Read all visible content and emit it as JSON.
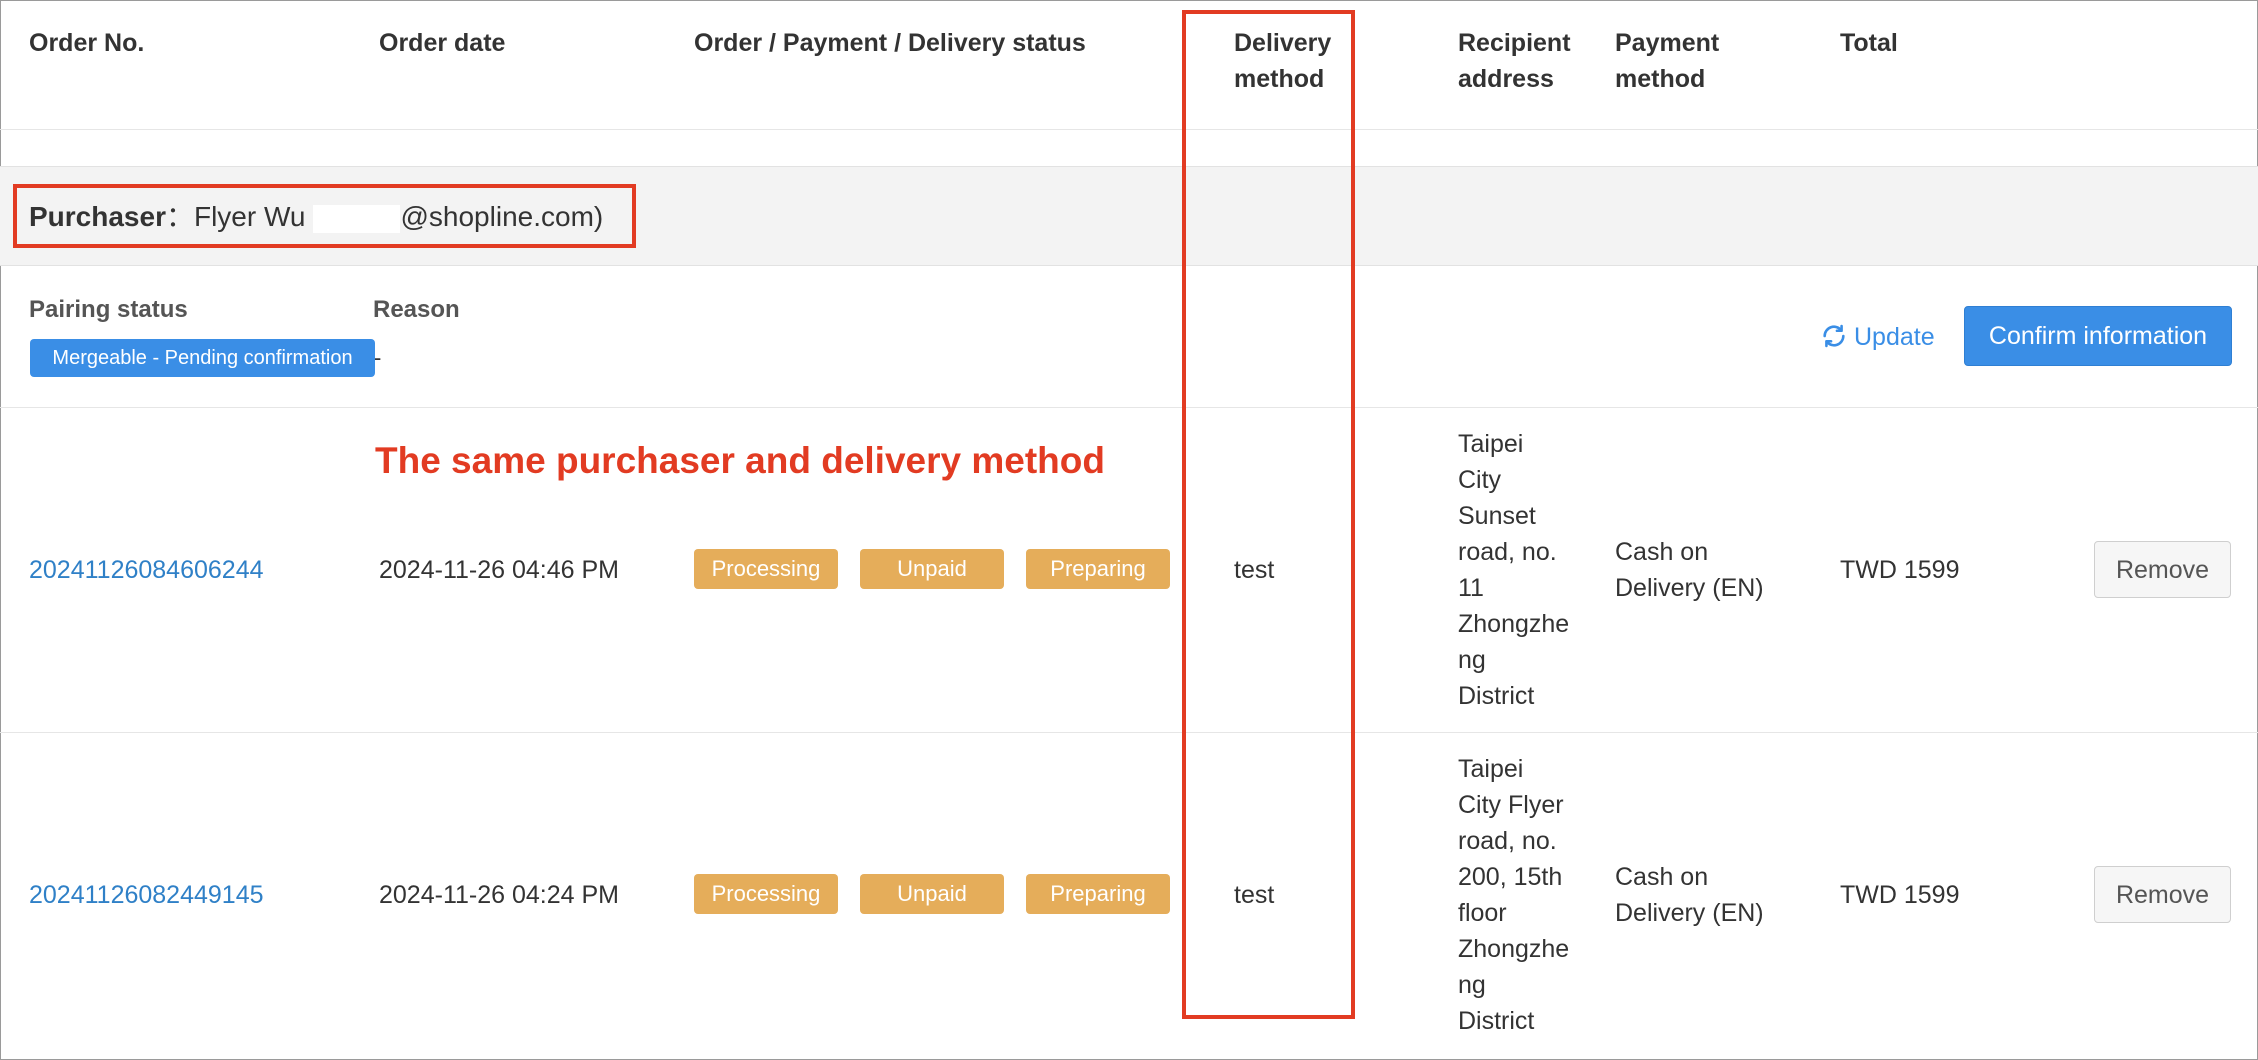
{
  "table": {
    "headers": {
      "order_no": "Order No.",
      "order_date": "Order date",
      "status": "Order / Payment / Delivery status",
      "delivery_method_line1": "Delivery",
      "delivery_method_line2": "method",
      "recipient_address_line1": "Recipient",
      "recipient_address_line2": "address",
      "payment_method_line1": "Payment",
      "payment_method_line2": "method",
      "total": "Total"
    }
  },
  "purchaser": {
    "label": "Purchaser",
    "separator": "：",
    "name": "Flyer Wu",
    "email_suffix": "@shopline.com)"
  },
  "group": {
    "pairing_status_label": "Pairing status",
    "reason_label": "Reason",
    "pairing_badge": "Mergeable - Pending confirmation",
    "reason_value": "-",
    "update_label": "Update",
    "confirm_label": "Confirm information"
  },
  "annotation": {
    "text": "The same purchaser and delivery method",
    "color": "#e23b22"
  },
  "orders": [
    {
      "order_no": "20241126084606244",
      "order_date": "2024-11-26 04:46 PM",
      "order_status": "Processing",
      "payment_status": "Unpaid",
      "delivery_status": "Preparing",
      "delivery_method": "test",
      "address_lines": [
        "Taipei",
        "City",
        "Sunset",
        "road, no.",
        "11",
        "Zhongzhe",
        "ng",
        "District"
      ],
      "payment_method_line1": "Cash on",
      "payment_method_line2": "Delivery (EN)",
      "total": "TWD 1599",
      "remove_label": "Remove"
    },
    {
      "order_no": "20241126082449145",
      "order_date": "2024-11-26 04:24 PM",
      "order_status": "Processing",
      "payment_status": "Unpaid",
      "delivery_status": "Preparing",
      "delivery_method": "test",
      "address_lines": [
        "Taipei",
        "City Flyer",
        "road, no.",
        "200, 15th",
        "floor",
        "Zhongzhe",
        "ng",
        "District"
      ],
      "payment_method_line1": "Cash on",
      "payment_method_line2": "Delivery (EN)",
      "total": "TWD 1599",
      "remove_label": "Remove"
    }
  ],
  "colors": {
    "link": "#2f80c7",
    "badge_orange": "#e5ad5a",
    "pairing_blue": "#3a8ee6",
    "confirm_blue": "#3a8ee6",
    "highlight_red": "#e23b22"
  },
  "icons": {
    "update": "refresh-icon"
  }
}
